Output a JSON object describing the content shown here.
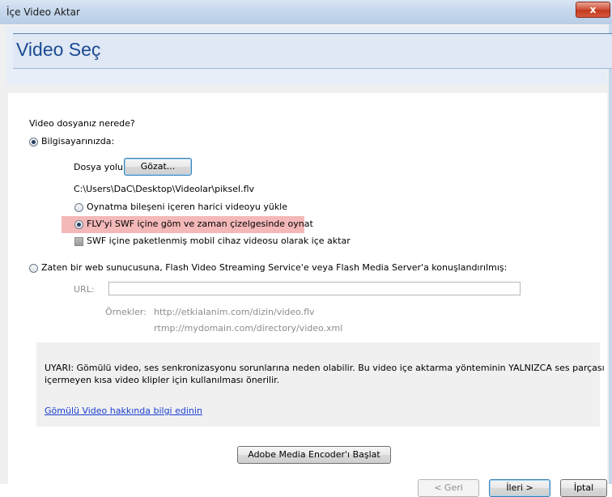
{
  "window": {
    "title": "İçe Video Aktar",
    "close_label": "x"
  },
  "page": {
    "title": "Video Seç"
  },
  "question": "Video dosyanız nerede?",
  "local": {
    "radio_label": "Bilgisayarınızda:",
    "path_label": "Dosya yolu:",
    "browse_label": "Gözat...",
    "path_value": "C:\\Users\\DaC\\Desktop\\Videolar\\piksel.flv",
    "options": [
      "Oynatma bileşeni içeren harici videoyu yükle",
      "FLV'yi SWF içine göm ve zaman çizelgesinde oynat",
      "SWF içine paketlenmiş mobil cihaz videosu olarak içe aktar"
    ]
  },
  "server": {
    "radio_label": "Zaten bir web sunucusuna, Flash Video Streaming Service'e veya Flash Media Server'a konuşlandırılmış:",
    "url_label": "URL:",
    "examples_label": "Örnekler:",
    "examples": [
      "http://etkialanim.com/dizin/video.flv",
      "rtmp://mydomain.com/directory/video.xml"
    ]
  },
  "warning": {
    "text_line1": "UYARI: Gömülü video, ses senkronizasyonu sorunlarına neden olabilir. Bu video içe aktarma yönteminin YALNIZCA ses parçası",
    "text_line2": "içermeyen kısa video klipler için kullanılması önerilir.",
    "link": "Gömülü Video hakkında bilgi edinin"
  },
  "encoder_button": "Adobe Media Encoder'ı Başlat",
  "footer": {
    "back": "< Geri",
    "next": "İleri >",
    "cancel": "İptal"
  },
  "colors": {
    "title_blue": "#1b4a94",
    "highlight": "#f4b8b8",
    "link": "#1a3fd3"
  }
}
